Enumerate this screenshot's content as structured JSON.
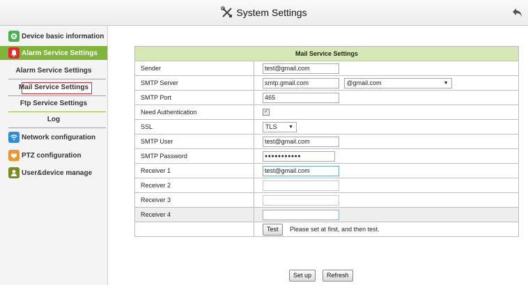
{
  "header": {
    "title": "System Settings",
    "tools_icon": "tools-icon",
    "back_icon": "back-arrow-icon"
  },
  "sidebar": {
    "device_basic_info": "Device basic information",
    "alarm_service_settings": "Alarm Service Settings",
    "sub_alarm": "Alarm Service Settings",
    "sub_mail": "Mail Service Settings",
    "sub_ftp": "Ftp Service Settings",
    "sub_log": "Log",
    "network_configuration": "Network configuration",
    "ptz_configuration": "PTZ configuration",
    "user_device_manage": "User&device manage",
    "active_color": "#e8262b",
    "accent_green": "#8fbf3c"
  },
  "form": {
    "heading": "Mail Service Settings",
    "sender_label": "Sender",
    "sender_value": "test@gmail.com",
    "smtp_server_label": "SMTP Server",
    "smtp_server_value": "smtp.gmail.com",
    "smtp_server_domain": "@gmail.com",
    "smtp_port_label": "SMTP Port",
    "smtp_port_value": "465",
    "need_auth_label": "Need Authentication",
    "need_auth_checked": true,
    "ssl_label": "SSL",
    "ssl_value": "TLS",
    "smtp_user_label": "SMTP User",
    "smtp_user_value": "test@gmail.com",
    "smtp_password_label": "SMTP Password",
    "smtp_password_value": "●●●●●●●●●●●",
    "receiver1_label": "Receiver 1",
    "receiver1_value": "test@gmail.com",
    "receiver2_label": "Receiver 2",
    "receiver2_value": "",
    "receiver3_label": "Receiver 3",
    "receiver3_value": "",
    "receiver4_label": "Receiver 4",
    "receiver4_value": "",
    "test_button": "Test",
    "test_hint": "Please set at first, and then test."
  },
  "actions": {
    "setup_button": "Set up",
    "refresh_button": "Refresh"
  }
}
